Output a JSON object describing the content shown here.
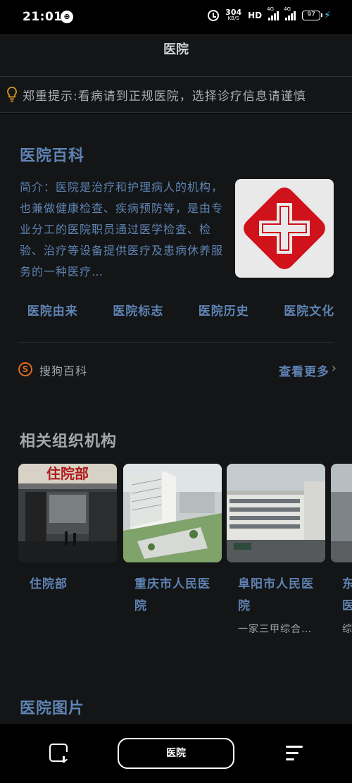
{
  "status_bar": {
    "time": "21:01",
    "notif_glyph": "⊕",
    "net_speed_value": "304",
    "net_speed_unit": "KB/S",
    "hd": "HD",
    "signal1_label": "4G",
    "signal2_label": "4G",
    "battery": "97"
  },
  "header": {
    "title": "医院"
  },
  "notice": {
    "text": "郑重提示:看病请到正规医院，选择诊疗信息请谨慎"
  },
  "encyclopedia": {
    "title": "医院百科",
    "intro": "简介：医院是治疗和护理病人的机构，也兼做健康检查、疾病预防等，是由专业分工的医院职员通过医学检查、检验、治疗等设备提供医疗及患病休养服务的一种医疗…",
    "links": [
      "医院由来",
      "医院标志",
      "医院历史",
      "医院文化"
    ],
    "source": "搜狗百科",
    "more": "查看更多"
  },
  "related": {
    "title": "相关组织机构",
    "cards": [
      {
        "title": "住院部",
        "subtitle": "",
        "sign_text": "住院部"
      },
      {
        "title": "重庆市人民医院",
        "subtitle": ""
      },
      {
        "title": "阜阳市人民医院",
        "subtitle": "一家三甲综合…"
      },
      {
        "title": "东…医…",
        "subtitle": "综"
      }
    ]
  },
  "pictures": {
    "title": "医院图片"
  },
  "bottom_nav": {
    "search_label": "医院"
  },
  "colors": {
    "accent_blue": "#5e83b3",
    "bg": "#131516",
    "logo_red": "#d0121b",
    "sogou_orange": "#d86c1f"
  },
  "icons": [
    "notification-icon",
    "alarm-icon",
    "battery-icon",
    "bulb-icon",
    "hospital-cross-logo",
    "sogou-icon",
    "chevron-right-icon",
    "tabs-icon",
    "menu-icon"
  ]
}
